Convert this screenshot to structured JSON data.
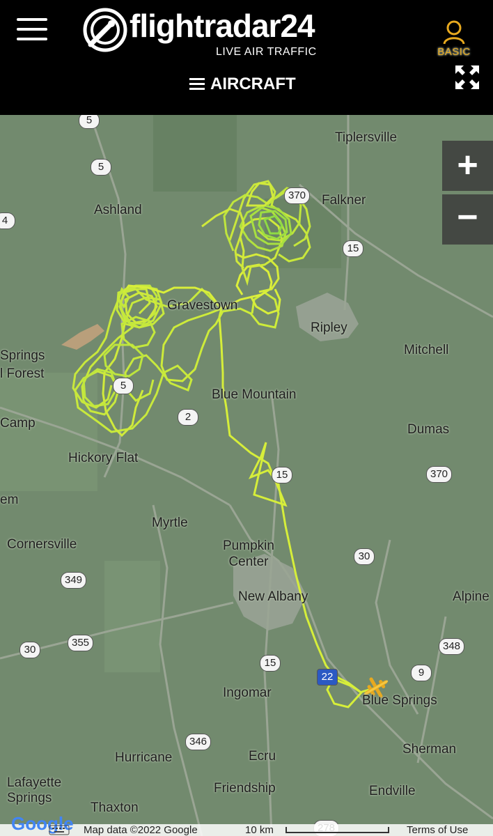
{
  "header": {
    "logo_word": "flightradar",
    "logo_num": "24",
    "tagline": "LIVE AIR TRAFFIC",
    "account_label": "BASIC",
    "nav_label": "AIRCRAFT"
  },
  "map": {
    "places": {
      "tiplersville": "Tiplersville",
      "ashland": "Ashland",
      "falkner": "Falkner",
      "gravestown": "Gravestown",
      "ripley": "Ripley",
      "mitchell": "Mitchell",
      "springs": "Springs",
      "forest": "l Forest",
      "blue_mountain": "Blue Mountain",
      "camp": "Camp",
      "dumas": "Dumas",
      "hickory_flat": "Hickory Flat",
      "em": "em",
      "myrtle": "Myrtle",
      "cornersville": "Cornersville",
      "pumpkin_center": "Pumpkin\nCenter",
      "new_albany": "New Albany",
      "alpine": "Alpine",
      "ingomar": "Ingomar",
      "blue_springs": "Blue Springs",
      "sherman": "Sherman",
      "hurricane": "Hurricane",
      "ecru": "Ecru",
      "lafayette_springs": "Lafayette\nSprings",
      "friendship": "Friendship",
      "thaxton": "Thaxton",
      "endville": "Endville"
    },
    "routes": {
      "r5a": "5",
      "r5b": "5",
      "r5c": "5",
      "r370a": "370",
      "r15a": "15",
      "r2": "2",
      "r15b": "15",
      "r370b": "370",
      "r30a": "30",
      "r349": "349",
      "r355": "355",
      "r30b": "30",
      "r15c": "15",
      "r348": "348",
      "r9": "9",
      "r22": "22",
      "r346": "346",
      "r4": "4",
      "r278": "278"
    },
    "zoom_in": "+",
    "zoom_out": "−"
  },
  "footer": {
    "google": "Google",
    "map_data": "Map data ©2022 Google",
    "scale": "10 km",
    "terms": "Terms of Use"
  },
  "colors": {
    "brand_accent": "#e7a91f",
    "track_yellow": "#e4f23b",
    "track_green": "#9ee64a",
    "aircraft": "#f1c40f"
  }
}
